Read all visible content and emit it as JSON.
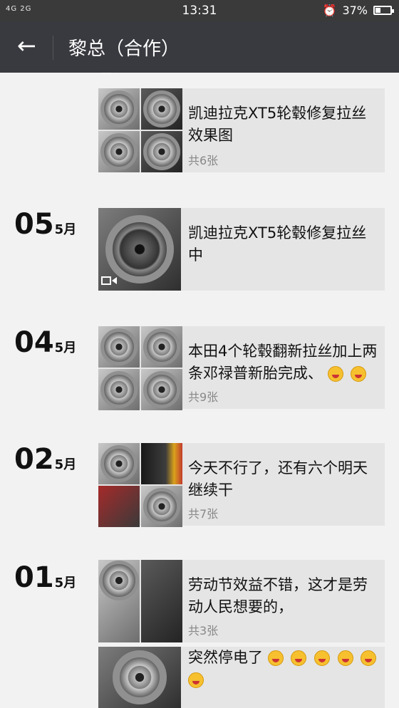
{
  "status": {
    "network": "4G 2G",
    "time": "13:31",
    "battery": "37%"
  },
  "header": {
    "back_icon": "←",
    "title": "黎总（合作）"
  },
  "posts": [
    {
      "text": "凯迪拉克XT5轮毂修复拉丝效果图",
      "count": "共6张"
    },
    {
      "day": "05",
      "month": "5月",
      "text": "凯迪拉克XT5轮毂修复拉丝中"
    },
    {
      "day": "04",
      "month": "5月",
      "text": "本田4个轮毂翻新拉丝加上两条邓禄普新胎完成、",
      "count": "共9张"
    },
    {
      "day": "02",
      "month": "5月",
      "text": "今天不行了，还有六个明天继续干",
      "count": "共7张"
    },
    {
      "day": "01",
      "month": "5月",
      "text": "劳动节效益不错，这才是劳动人民想要的，",
      "count": "共3张"
    },
    {
      "text": "突然停电了"
    }
  ]
}
